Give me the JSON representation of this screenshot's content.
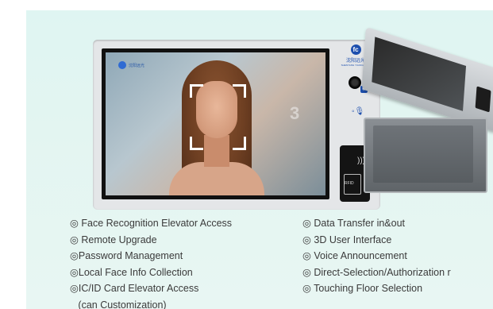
{
  "device": {
    "display_logo_text": "沈阳远光",
    "overlay_number": "3",
    "brand_logo_letters": "fc",
    "brand_cn": "沈阳远光",
    "brand_en": "SHENYANG YUANGUANG",
    "rfid_label": "RFID",
    "mic_icon": "microphone-icon",
    "camera_icon": "camera-icon"
  },
  "features": {
    "left": [
      "◎ Face Recognition Elevator Access",
      "◎ Remote Upgrade",
      "◎Password Management",
      "◎Local Face Info Collection",
      "◎IC/ID Card Elevator Access",
      "   (can Customization)"
    ],
    "right": [
      "◎ Data Transfer in&out",
      "◎ 3D User Interface",
      "◎ Voice Announcement",
      "◎ Direct-Selection/Authorization r",
      "◎ Touching Floor Selection"
    ]
  },
  "colors": {
    "panel_bg": "#e1f5f2",
    "brand_blue": "#1d4fae",
    "text": "#3a3a3a"
  }
}
